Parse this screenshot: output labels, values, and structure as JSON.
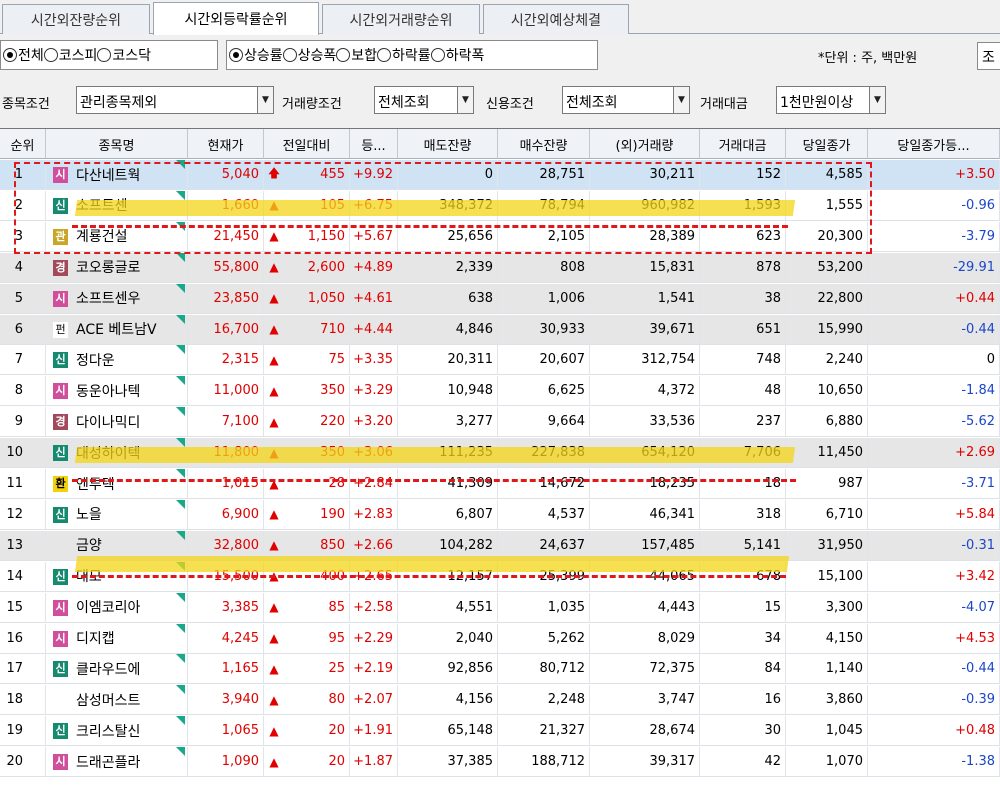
{
  "tabs": [
    "시간외잔량순위",
    "시간외등락률순위",
    "시간외거래량순위",
    "시간외예상체결"
  ],
  "radios": {
    "market": [
      "전체",
      "코스피",
      "코스닥"
    ],
    "sort": [
      "상승률",
      "상승폭",
      "보합",
      "하락률",
      "하락폭"
    ]
  },
  "unit_label": "*단위 : 주, 백만원",
  "unit_select": "조",
  "filters": [
    {
      "label": "종목조건",
      "value": "관리종목제외"
    },
    {
      "label": "거래량조건",
      "value": "전체조회"
    },
    {
      "label": "신용조건",
      "value": "전체조회"
    },
    {
      "label": "거래대금",
      "value": "1천만원이상"
    }
  ],
  "columns": [
    "순위",
    "종목명",
    "현재가",
    "전일대비",
    "등...",
    "매도잔량",
    "매수잔량",
    "(외)거래량",
    "거래대금",
    "당일종가",
    "당일종가등..."
  ],
  "rows": [
    {
      "rank": "1",
      "badge": "시",
      "name": "다산네트웍",
      "price": "5,040",
      "arrow": "up-arrow",
      "change": "455",
      "pct": "+9.92",
      "sell": "0",
      "buy": "28,751",
      "volume": "30,211",
      "amount": "152",
      "close": "4,585",
      "close_pct": "+3.50"
    },
    {
      "rank": "2",
      "badge": "신",
      "name": "소프트센",
      "price": "1,660",
      "arrow": "triangle",
      "change": "105",
      "pct": "+6.75",
      "sell": "348,372",
      "buy": "78,794",
      "volume": "960,982",
      "amount": "1,593",
      "close": "1,555",
      "close_pct": "-0.96"
    },
    {
      "rank": "3",
      "badge": "관",
      "name": "계룡건설",
      "price": "21,450",
      "arrow": "triangle",
      "change": "1,150",
      "pct": "+5.67",
      "sell": "25,656",
      "buy": "2,105",
      "volume": "28,389",
      "amount": "623",
      "close": "20,300",
      "close_pct": "-3.79"
    },
    {
      "rank": "4",
      "badge": "경",
      "name": "코오롱글로",
      "price": "55,800",
      "arrow": "triangle",
      "change": "2,600",
      "pct": "+4.89",
      "sell": "2,339",
      "buy": "808",
      "volume": "15,831",
      "amount": "878",
      "close": "53,200",
      "close_pct": "-29.91"
    },
    {
      "rank": "5",
      "badge": "시",
      "name": "소프트센우",
      "price": "23,850",
      "arrow": "triangle",
      "change": "1,050",
      "pct": "+4.61",
      "sell": "638",
      "buy": "1,006",
      "volume": "1,541",
      "amount": "38",
      "close": "22,800",
      "close_pct": "+0.44"
    },
    {
      "rank": "6",
      "badge": "펀",
      "name": "ACE 베트남V",
      "price": "16,700",
      "arrow": "triangle",
      "change": "710",
      "pct": "+4.44",
      "sell": "4,846",
      "buy": "30,933",
      "volume": "39,671",
      "amount": "651",
      "close": "15,990",
      "close_pct": "-0.44"
    },
    {
      "rank": "7",
      "badge": "신",
      "name": "정다운",
      "price": "2,315",
      "arrow": "triangle",
      "change": "75",
      "pct": "+3.35",
      "sell": "20,311",
      "buy": "20,607",
      "volume": "312,754",
      "amount": "748",
      "close": "2,240",
      "close_pct": "0"
    },
    {
      "rank": "8",
      "badge": "시",
      "name": "동운아나텍",
      "price": "11,000",
      "arrow": "triangle",
      "change": "350",
      "pct": "+3.29",
      "sell": "10,948",
      "buy": "6,625",
      "volume": "4,372",
      "amount": "48",
      "close": "10,650",
      "close_pct": "-1.84"
    },
    {
      "rank": "9",
      "badge": "경",
      "name": "다이나믹디",
      "price": "7,100",
      "arrow": "triangle",
      "change": "220",
      "pct": "+3.20",
      "sell": "3,277",
      "buy": "9,664",
      "volume": "33,536",
      "amount": "237",
      "close": "6,880",
      "close_pct": "-5.62"
    },
    {
      "rank": "10",
      "badge": "신",
      "name": "대성하이텍",
      "price": "11,800",
      "arrow": "triangle",
      "change": "350",
      "pct": "+3.06",
      "sell": "111,235",
      "buy": "227,838",
      "volume": "654,120",
      "amount": "7,706",
      "close": "11,450",
      "close_pct": "+2.69"
    },
    {
      "rank": "11",
      "badge": "환",
      "name": "엔투텍",
      "price": "1,015",
      "arrow": "triangle",
      "change": "28",
      "pct": "+2.84",
      "sell": "41,309",
      "buy": "14,672",
      "volume": "18,235",
      "amount": "18",
      "close": "987",
      "close_pct": "-3.71"
    },
    {
      "rank": "12",
      "badge": "신",
      "name": "노을",
      "price": "6,900",
      "arrow": "triangle",
      "change": "190",
      "pct": "+2.83",
      "sell": "6,807",
      "buy": "4,537",
      "volume": "46,341",
      "amount": "318",
      "close": "6,710",
      "close_pct": "+5.84"
    },
    {
      "rank": "13",
      "badge": "",
      "name": "금양",
      "price": "32,800",
      "arrow": "triangle",
      "change": "850",
      "pct": "+2.66",
      "sell": "104,282",
      "buy": "24,637",
      "volume": "157,485",
      "amount": "5,141",
      "close": "31,950",
      "close_pct": "-0.31"
    },
    {
      "rank": "14",
      "badge": "신",
      "name": "대모",
      "price": "15,500",
      "arrow": "triangle",
      "change": "400",
      "pct": "+2.65",
      "sell": "12,157",
      "buy": "25,399",
      "volume": "44,065",
      "amount": "678",
      "close": "15,100",
      "close_pct": "+3.42"
    },
    {
      "rank": "15",
      "badge": "시",
      "name": "이엠코리아",
      "price": "3,385",
      "arrow": "triangle",
      "change": "85",
      "pct": "+2.58",
      "sell": "4,551",
      "buy": "1,035",
      "volume": "4,443",
      "amount": "15",
      "close": "3,300",
      "close_pct": "-4.07"
    },
    {
      "rank": "16",
      "badge": "시",
      "name": "디지캡",
      "price": "4,245",
      "arrow": "triangle",
      "change": "95",
      "pct": "+2.29",
      "sell": "2,040",
      "buy": "5,262",
      "volume": "8,029",
      "amount": "34",
      "close": "4,150",
      "close_pct": "+4.53"
    },
    {
      "rank": "17",
      "badge": "신",
      "name": "클라우드에",
      "price": "1,165",
      "arrow": "triangle",
      "change": "25",
      "pct": "+2.19",
      "sell": "92,856",
      "buy": "80,712",
      "volume": "72,375",
      "amount": "84",
      "close": "1,140",
      "close_pct": "-0.44"
    },
    {
      "rank": "18",
      "badge": "",
      "name": "삼성머스트",
      "price": "3,940",
      "arrow": "triangle",
      "change": "80",
      "pct": "+2.07",
      "sell": "4,156",
      "buy": "2,248",
      "volume": "3,747",
      "amount": "16",
      "close": "3,860",
      "close_pct": "-0.39"
    },
    {
      "rank": "19",
      "badge": "신",
      "name": "크리스탈신",
      "price": "1,065",
      "arrow": "triangle",
      "change": "20",
      "pct": "+1.91",
      "sell": "65,148",
      "buy": "21,327",
      "volume": "28,674",
      "amount": "30",
      "close": "1,045",
      "close_pct": "+0.48"
    },
    {
      "rank": "20",
      "badge": "시",
      "name": "드래곤플라",
      "price": "1,090",
      "arrow": "triangle",
      "change": "20",
      "pct": "+1.87",
      "sell": "37,385",
      "buy": "188,712",
      "volume": "39,317",
      "amount": "42",
      "close": "1,070",
      "close_pct": "-1.38"
    }
  ],
  "colors": {
    "up": "#e00000",
    "down": "#1a47c8",
    "selected_row": "#cfe3f4",
    "gray_row": "#e6e6e6",
    "highlight": "#f3d518",
    "annotation": "#e0181a"
  }
}
